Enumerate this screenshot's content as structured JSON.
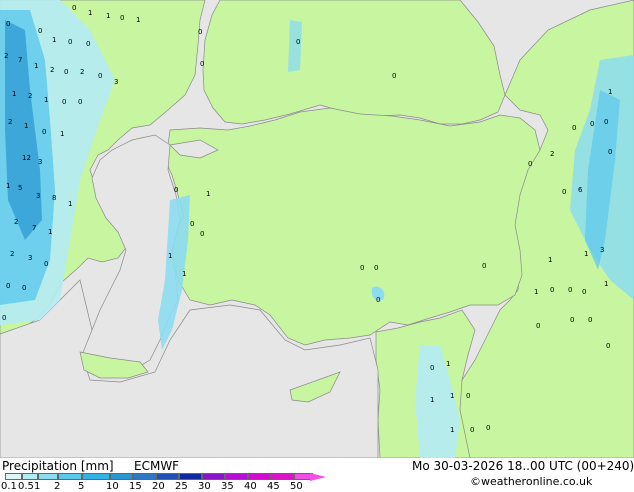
{
  "title": "Precipitation [mm]",
  "model": "ECMWF",
  "valid_time": "Mo 30-03-2026 18..00 UTC (00+240)",
  "credit": "©weatheronline.co.uk",
  "legend": {
    "ticks": [
      "0.1",
      "0.5",
      "1",
      "2",
      "5",
      "10",
      "15",
      "20",
      "25",
      "30",
      "35",
      "40",
      "45",
      "50"
    ],
    "colors": [
      "#dff6f9",
      "#b4ecf4",
      "#8cdcef",
      "#5cc8ec",
      "#32b2e6",
      "#2896d2",
      "#2a78c8",
      "#2050b4",
      "#1428a0",
      "#8c14c8",
      "#b40fd2",
      "#d20ad2",
      "#dc14c8",
      "#f050e6"
    ]
  },
  "colors": {
    "sea": "#e6e6e6",
    "land": "#c8f5a0",
    "rain_light": "#b4ecf4",
    "rain_medium": "#5cc8ec",
    "rain_heavy": "#2896d2"
  },
  "map_labels": [
    "0",
    "1",
    "1",
    "0",
    "1",
    "0",
    "0",
    "1",
    "0",
    "0",
    "2",
    "7",
    "1",
    "2",
    "0",
    "2",
    "0",
    "3",
    "1",
    "2",
    "1",
    "0",
    "0",
    "2",
    "1",
    "0",
    "1",
    "12",
    "3",
    "1",
    "5",
    "3",
    "8",
    "1",
    "2",
    "7",
    "1",
    "2",
    "3",
    "0",
    "0",
    "0",
    "0",
    "0",
    "0",
    "0",
    "0",
    "0",
    "1",
    "0",
    "0",
    "1",
    "1",
    "0",
    "0",
    "0",
    "0",
    "0",
    "2",
    "0",
    "0",
    "0",
    "1",
    "0",
    "0",
    "6",
    "1",
    "3",
    "1",
    "1",
    "1",
    "0",
    "0",
    "0",
    "0",
    "0",
    "0",
    "0",
    "0",
    "1",
    "1",
    "1",
    "0",
    "1",
    "0",
    "0"
  ]
}
